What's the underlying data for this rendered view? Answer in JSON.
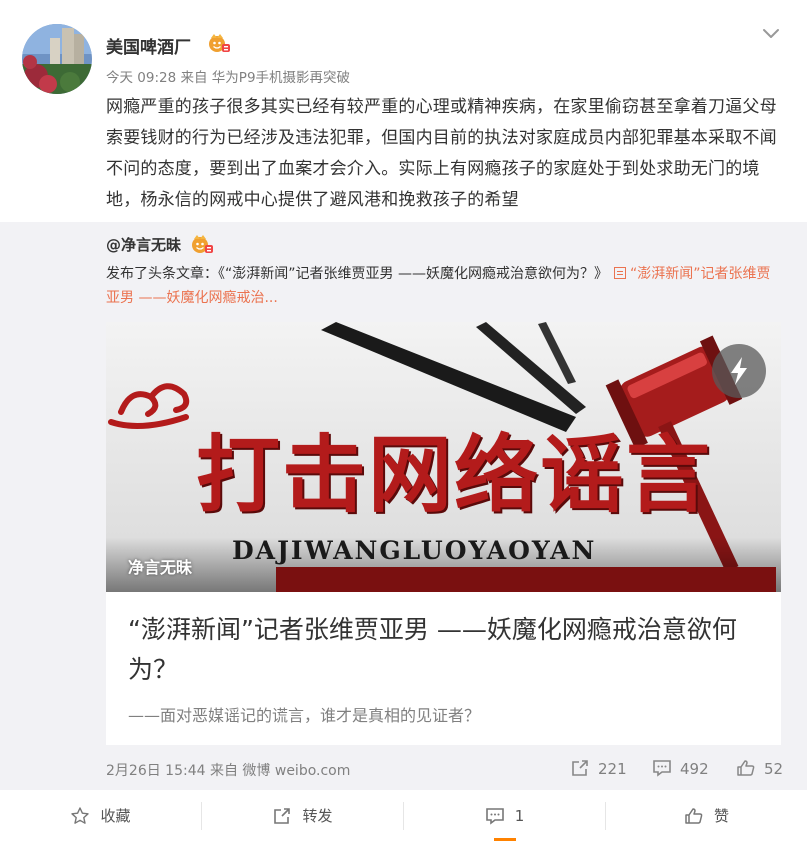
{
  "post": {
    "username": "美国啤酒厂",
    "vip_icon": "vip-crown-icon",
    "time": "今天 09:28",
    "from_label": "来自",
    "device": "华为P9手机摄影再突破",
    "text": "网瘾严重的孩子很多其实已经有较严重的心理或精神疾病，在家里偷窃甚至拿着刀逼父母索要钱财的行为已经涉及违法犯罪，但国内目前的执法对家庭成员内部犯罪基本采取不闻不问的态度，要到出了血案才会介入。实际上有网瘾孩子的家庭处于到处求助无门的境地，杨永信的网戒中心提供了避风港和挽救孩子的希望",
    "collapse_icon": "chevron-down-icon"
  },
  "repost": {
    "author": "@净言无昧",
    "published_prefix": "发布了头条文章：《“澎湃新闻”记者张维贾亚男 ——妖魔化网瘾戒治意欲何为？》",
    "link_text": "“澎湃新闻”记者张维贾亚男 ——妖魔化网瘾戒治...",
    "card": {
      "banner_text": "打击网络谣言",
      "banner_pinyin": "DAJIWANGLUOYAOYAN",
      "watermark": "净言无昧",
      "title": "“澎湃新闻”记者张维贾亚男 ——妖魔化网瘾戒治意欲何为？",
      "subtitle": "——面对恶媒谣记的谎言，谁才是真相的见证者？"
    },
    "meta": "2月26日 15:44 来自 微博 weibo.com",
    "stats": {
      "repost_count": "221",
      "comment_count": "492",
      "like_count": "52"
    }
  },
  "actions": {
    "favorite_label": "收藏",
    "forward_label": "转发",
    "comment_label": "1",
    "like_label": "赞"
  },
  "colors": {
    "link": "#eb7350",
    "active_tab": "#ff8200",
    "repost_bg": "#f2f2f5",
    "banner_red": "#b31b1b"
  }
}
